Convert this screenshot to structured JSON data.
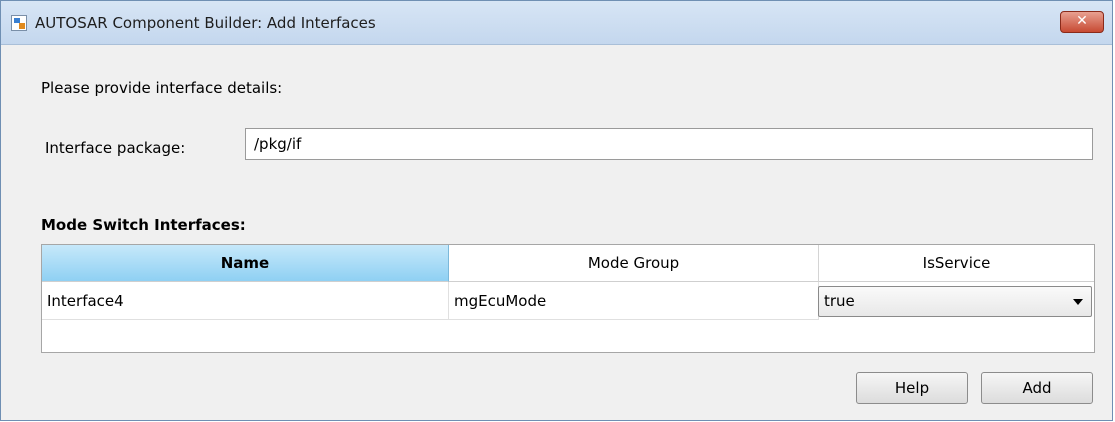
{
  "window": {
    "title": "AUTOSAR Component Builder: Add Interfaces",
    "close_label": "✕"
  },
  "form": {
    "prompt": "Please provide interface details:",
    "package_label": "Interface package:",
    "package_value": "/pkg/if"
  },
  "section": {
    "title": "Mode Switch Interfaces:"
  },
  "table": {
    "columns": [
      "Name",
      "Mode Group",
      "IsService"
    ],
    "sorted_column": "Name",
    "rows": [
      {
        "name": "Interface4",
        "mode_group": "mgEcuMode",
        "is_service": "true"
      }
    ]
  },
  "buttons": {
    "help": "Help",
    "add": "Add"
  },
  "icons": {
    "app": "app-icon",
    "close": "close-icon",
    "dropdown": "chevron-down-icon"
  },
  "colors": {
    "titlebar": "#c4d7ee",
    "close_button": "#c74a33",
    "sorted_header": "#8fd0f3",
    "background": "#f0f0f0"
  }
}
